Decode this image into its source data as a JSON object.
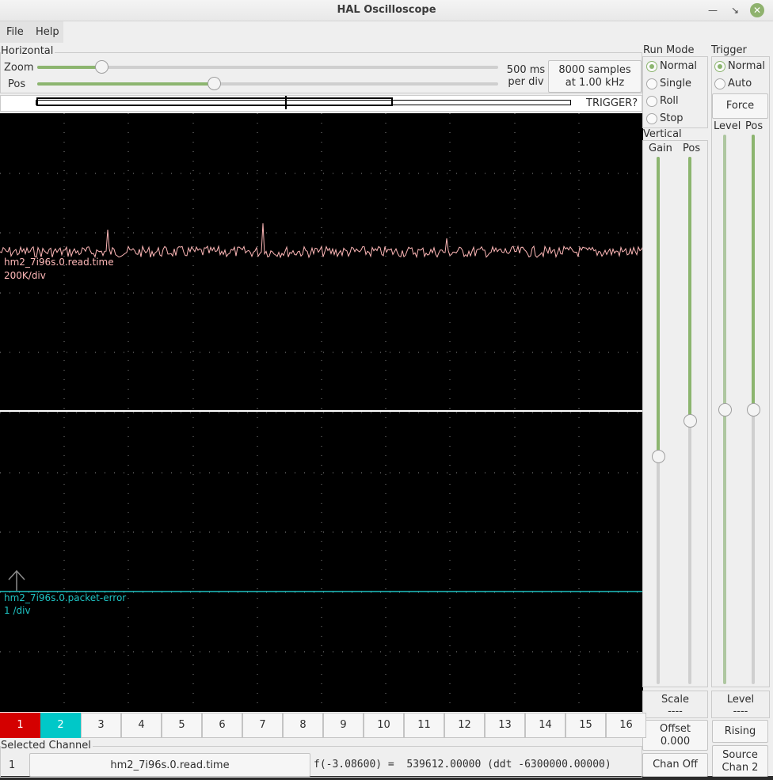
{
  "window": {
    "title": "HAL Oscilloscope"
  },
  "menu": {
    "file": "File",
    "help": "Help"
  },
  "horizontal": {
    "group_label": "Horizontal",
    "zoom_label": "Zoom",
    "pos_label": "Pos",
    "zoom_value": 0.13,
    "pos_value": 0.38,
    "time_per_div_line1": "500 ms",
    "time_per_div_line2": "per div",
    "samples_line1": "8000 samples",
    "samples_line2": "at 1.00 kHz",
    "trigger_status": "TRIGGER?"
  },
  "run_mode": {
    "label": "Run Mode",
    "options": [
      "Normal",
      "Single",
      "Roll",
      "Stop"
    ],
    "selected": "Normal"
  },
  "trigger": {
    "label": "Trigger",
    "options": [
      "Normal",
      "Auto"
    ],
    "selected": "Normal",
    "force_label": "Force",
    "level_label": "Level",
    "pos_label": "Pos",
    "level_value": 0.5,
    "pos_value": 0.5,
    "level_title": "Level",
    "level_readout": "----",
    "edge_label": "Rising",
    "source_line1": "Source",
    "source_line2": "Chan  2"
  },
  "vertical": {
    "label": "Vertical",
    "gain_label": "Gain",
    "pos_label": "Pos",
    "gain_value": 0.43,
    "pos_value": 0.5,
    "scale_label": "Scale",
    "scale_value": "----",
    "offset_label": "Offset",
    "offset_value": "0.000",
    "chan_off_label": "Chan Off"
  },
  "traces": [
    {
      "name": "hm2_7i96s.0.read.time",
      "scale": "200K/div",
      "color": "#ffb8b8"
    },
    {
      "name": "hm2_7i96s.0.packet-error",
      "scale": "1 /div",
      "color": "#1ec3c3"
    }
  ],
  "channels": {
    "labels": [
      "1",
      "2",
      "3",
      "4",
      "5",
      "6",
      "7",
      "8",
      "9",
      "10",
      "11",
      "12",
      "13",
      "14",
      "15",
      "16"
    ],
    "active": {
      "1": "#d40000",
      "2": "#00c8c8"
    }
  },
  "selected_channel": {
    "label": "Selected Channel",
    "number": "1",
    "name": "hm2_7i96s.0.read.time",
    "readout": "f(-3.08600) =  539612.00000 (ddt -6300000.00000)"
  },
  "icons": {
    "minimize": "minimize-icon",
    "restore": "restore-icon",
    "close": "close-icon",
    "trigger_marker": "trigger-arrow-icon"
  }
}
